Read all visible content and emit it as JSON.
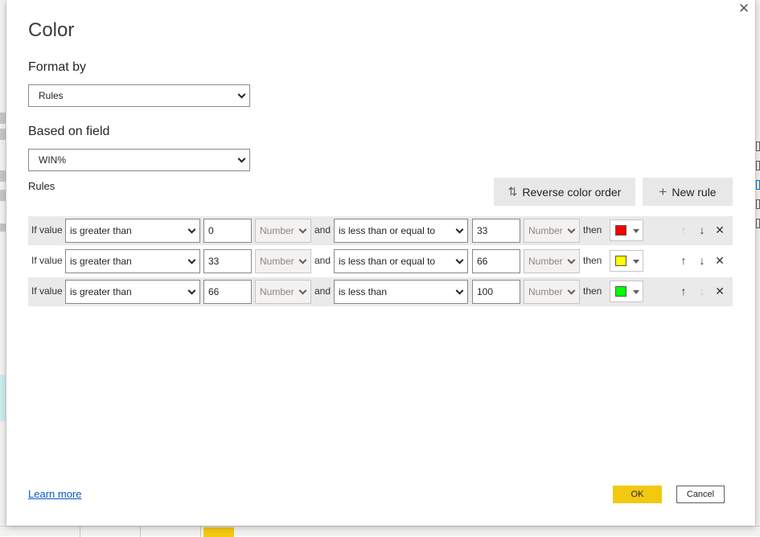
{
  "dialog": {
    "title": "Color",
    "close_icon": "close-icon",
    "format_by": {
      "label": "Format by",
      "value": "Rules"
    },
    "based_on_field": {
      "label": "Based on field",
      "value": "WIN%"
    },
    "rules_label": "Rules",
    "reverse_button": {
      "label": "Reverse color order",
      "icon": "sort-arrows-icon"
    },
    "new_rule_button": {
      "label": "New rule",
      "icon": "plus-icon"
    },
    "rules": [
      {
        "if_label": "If value",
        "op1": "is greater than",
        "val1": "0",
        "type1": "Number",
        "and_label": "and",
        "op2": "is less than or equal to",
        "val2": "33",
        "type2": "Number",
        "then_label": "then",
        "color": "#ff0000"
      },
      {
        "if_label": "If value",
        "op1": "is greater than",
        "val1": "33",
        "type1": "Number",
        "and_label": "and",
        "op2": "is less than or equal to",
        "val2": "66",
        "type2": "Number",
        "then_label": "then",
        "color": "#ffff00"
      },
      {
        "if_label": "If value",
        "op1": "is greater than",
        "val1": "66",
        "type1": "Number",
        "and_label": "and",
        "op2": "is less than",
        "val2": "100",
        "type2": "Number",
        "then_label": "then",
        "color": "#00ff00"
      }
    ],
    "learn_more": "Learn more",
    "ok_label": "OK",
    "cancel_label": "Cancel",
    "accent_color": "#f2c811",
    "link_color": "#0b58c4"
  }
}
